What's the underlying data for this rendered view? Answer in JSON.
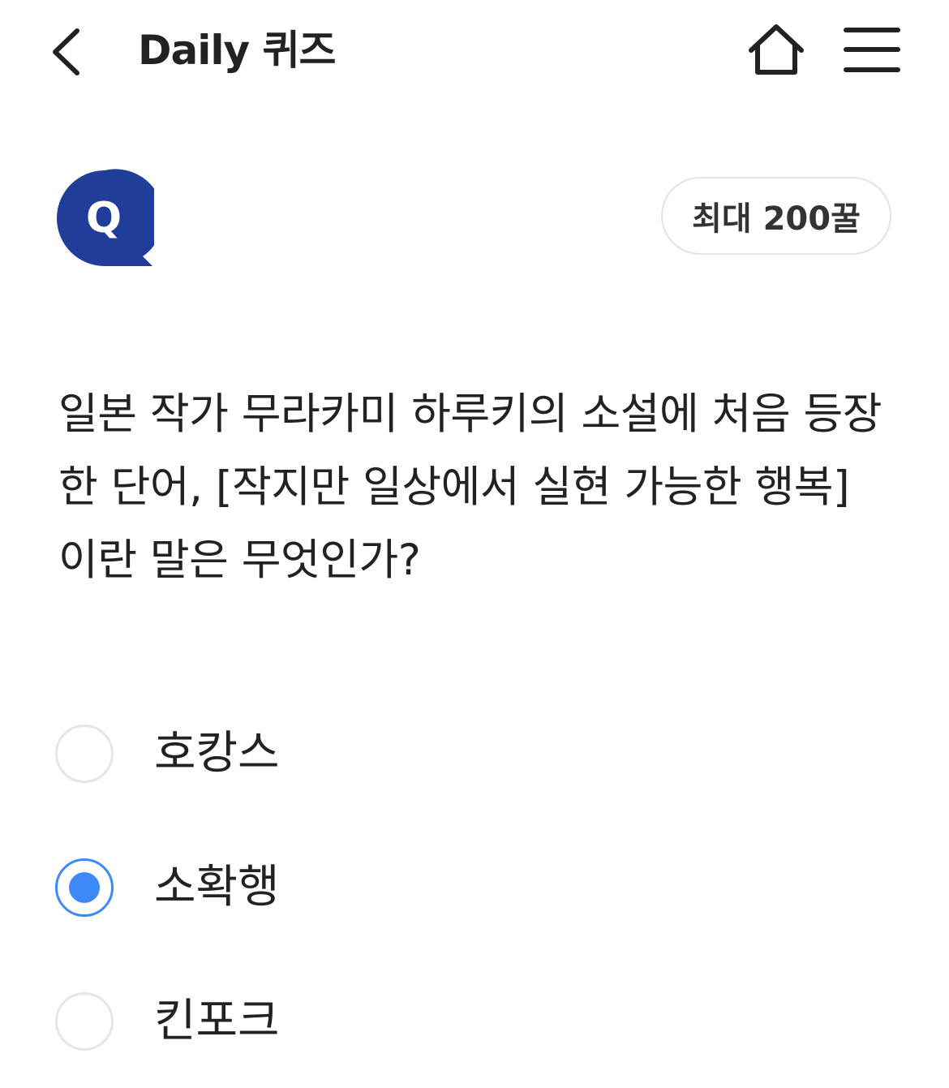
{
  "header": {
    "title": "Daily 퀴즈",
    "back_icon": "chevron-left-icon",
    "home_icon": "home-icon",
    "menu_icon": "hamburger-menu-icon"
  },
  "quiz": {
    "badge_letter": "Q",
    "badge_color": "#1f3d99",
    "points_label": "최대 200꿀",
    "question": "일본 작가 무라카미 하루키의 소설에 처음 등장한 단어, [작지만 일상에서 실현 가능한 행복]이란 말은 무엇인가?",
    "options": [
      {
        "label": "호캉스",
        "selected": false
      },
      {
        "label": "소확행",
        "selected": true
      },
      {
        "label": "킨포크",
        "selected": false
      }
    ],
    "accent_color": "#3d8af7"
  }
}
